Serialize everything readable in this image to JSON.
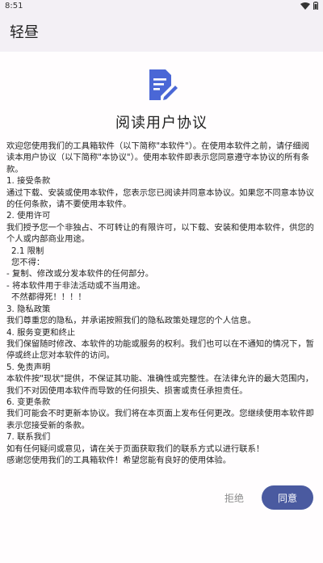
{
  "status_bar": {
    "time": "8:51"
  },
  "app_bar": {
    "title": "轻昼"
  },
  "icon": {
    "name": "document-edit-icon",
    "color": "#4a67d6"
  },
  "agreement": {
    "title": "阅读用户协议",
    "paragraphs": [
      {
        "text": "欢迎您使用我们的工具箱软件（以下简称\"本软件\"）。在使用本软件之前，请仔细阅读本用户协议（以下简称\"本协议\"）。使用本软件即表示您同意遵守本协议的所有条款。",
        "indent": 0
      },
      {
        "text": "1. 接受条款",
        "indent": 0
      },
      {
        "text": "通过下载、安装或使用本软件，您表示您已阅读并同意本协议。如果您不同意本协议的任何条款，请不要使用本软件。",
        "indent": 0
      },
      {
        "text": "2. 使用许可",
        "indent": 0
      },
      {
        "text": "我们授予您一个非独占、不可转让的有限许可，以下载、安装和使用本软件，供您的个人或内部商业用途。",
        "indent": 0
      },
      {
        "text": "2.1 限制",
        "indent": 1
      },
      {
        "text": "您不得：",
        "indent": 1
      },
      {
        "text": "- 复制、修改或分发本软件的任何部分。",
        "indent": 0
      },
      {
        "text": "- 将本软件用于非法活动或不当用途。",
        "indent": 0
      },
      {
        "text": "不然都得死！！！！",
        "indent": 1
      },
      {
        "text": "3. 隐私政策",
        "indent": 0
      },
      {
        "text": "我们尊重您的隐私，并承诺按照我们的隐私政策处理您的个人信息。",
        "indent": 0
      },
      {
        "text": "4. 服务变更和终止",
        "indent": 0
      },
      {
        "text": "我们保留随时修改、本软件的功能或服务的权利。我们也可以在不通知的情况下，暂停或终止您对本软件的访问。",
        "indent": 0
      },
      {
        "text": "5. 免责声明",
        "indent": 0
      },
      {
        "text": "本软件按\"现状\"提供，不保证其功能、准确性或完整性。在法律允许的最大范围内，我们不对因使用本软件而导致的任何损失、损害或责任承担责任。",
        "indent": 0
      },
      {
        "text": "6. 变更条款",
        "indent": 0
      },
      {
        "text": "我们可能会不时更新本协议。我们将在本页面上发布任何更改。您继续使用本软件即表示您接受新的条款。",
        "indent": 0
      },
      {
        "text": "7. 联系我们",
        "indent": 0
      },
      {
        "text": "如有任何疑问或意见，请在关于页面获取我们的联系方式以进行联系！",
        "indent": 0
      },
      {
        "text": "感谢您使用我们的工具箱软件！希望您能有良好的使用体验。",
        "indent": 0
      }
    ]
  },
  "buttons": {
    "reject_label": "拒绝",
    "agree_label": "同意"
  },
  "colors": {
    "accent": "#4a5aa0",
    "background": "#f3f0f5",
    "card": "#fffdfe"
  }
}
